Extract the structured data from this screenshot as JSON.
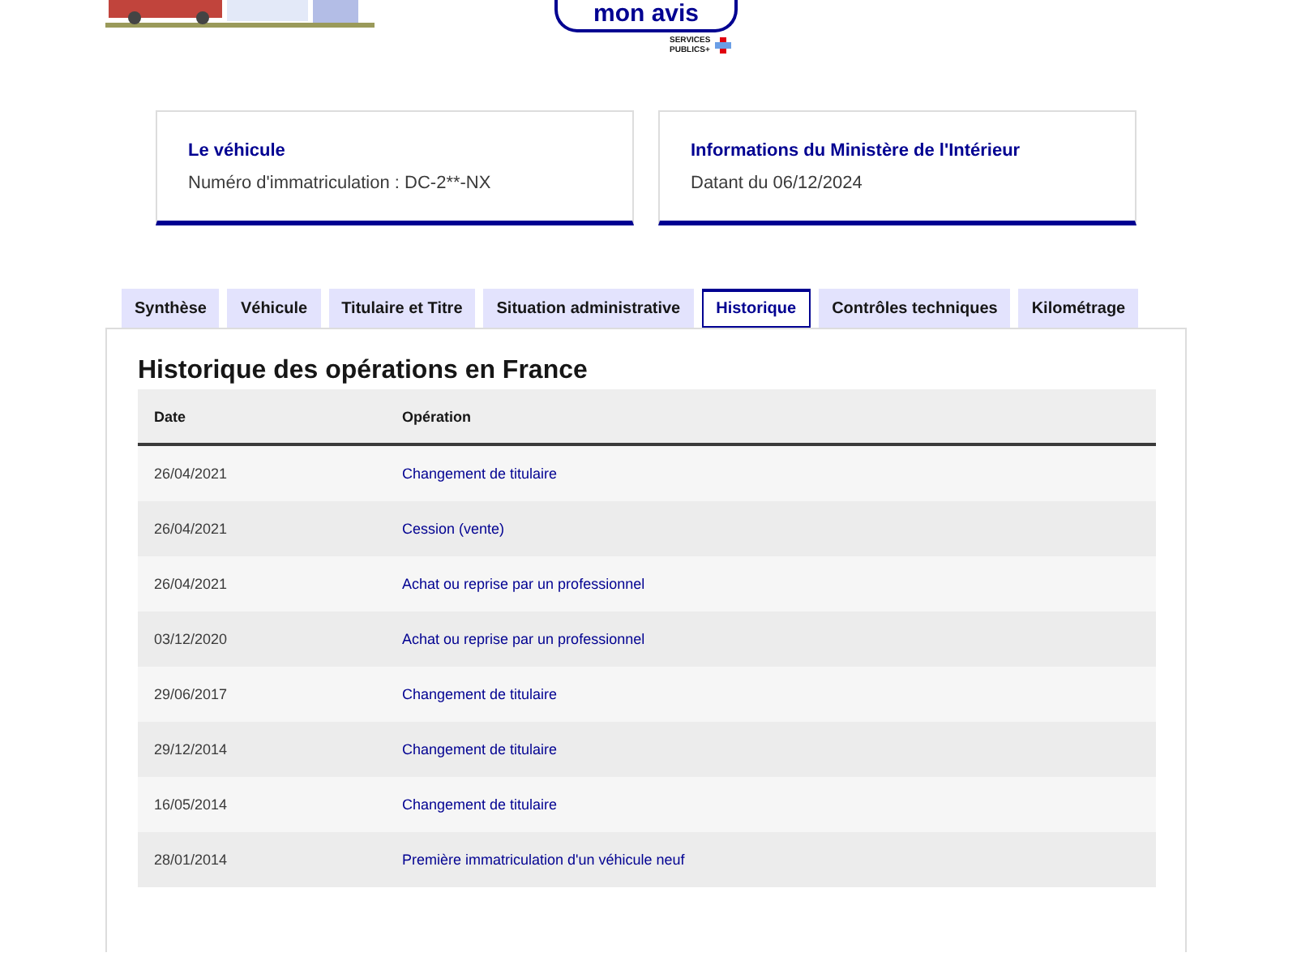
{
  "header": {
    "feedback_button": "mon avis",
    "logo_text": "SERVICES PUBLICS+"
  },
  "cards": [
    {
      "title": "Le véhicule",
      "text": "Numéro d'immatriculation : DC-2**-NX"
    },
    {
      "title": "Informations du Ministère de l'Intérieur",
      "text": "Datant du 06/12/2024"
    }
  ],
  "tabs": [
    {
      "label": "Synthèse",
      "selected": false
    },
    {
      "label": "Véhicule",
      "selected": false
    },
    {
      "label": "Titulaire et Titre",
      "selected": false
    },
    {
      "label": "Situation administrative",
      "selected": false
    },
    {
      "label": "Historique",
      "selected": true
    },
    {
      "label": "Contrôles techniques",
      "selected": false
    },
    {
      "label": "Kilométrage",
      "selected": false
    }
  ],
  "section": {
    "title": "Historique des opérations en France",
    "table": {
      "columns": [
        "Date",
        "Opération"
      ],
      "rows": [
        [
          "26/04/2021",
          "Changement de titulaire"
        ],
        [
          "26/04/2021",
          "Cession (vente)"
        ],
        [
          "26/04/2021",
          "Achat ou reprise par un professionnel"
        ],
        [
          "03/12/2020",
          "Achat ou reprise par un professionnel"
        ],
        [
          "29/06/2017",
          "Changement de titulaire"
        ],
        [
          "29/12/2014",
          "Changement de titulaire"
        ],
        [
          "16/05/2014",
          "Changement de titulaire"
        ],
        [
          "28/01/2014",
          "Première immatriculation d'un véhicule neuf"
        ]
      ]
    }
  }
}
